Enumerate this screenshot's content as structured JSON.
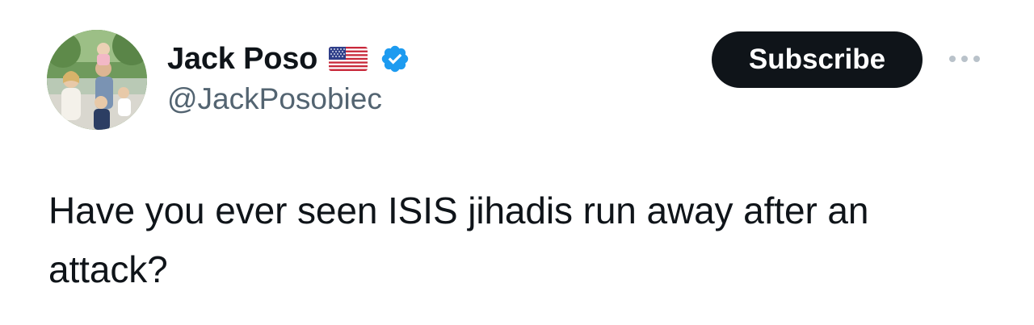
{
  "author": {
    "display_name": "Jack Poso",
    "flag_emoji": "us-flag-icon",
    "verified_badge": "verified-badge-icon",
    "handle": "@JackPosobiec"
  },
  "actions": {
    "subscribe_label": "Subscribe",
    "more_icon": "more-horizontal-icon"
  },
  "tweet": {
    "text": "Have you ever seen ISIS jihadis run away after an attack?"
  },
  "colors": {
    "primary_text": "#0f1419",
    "secondary_text": "#536471",
    "button_bg": "#0f1419",
    "button_text": "#ffffff",
    "verified_blue": "#1d9bf0",
    "more_dots": "#b9c2ca"
  }
}
